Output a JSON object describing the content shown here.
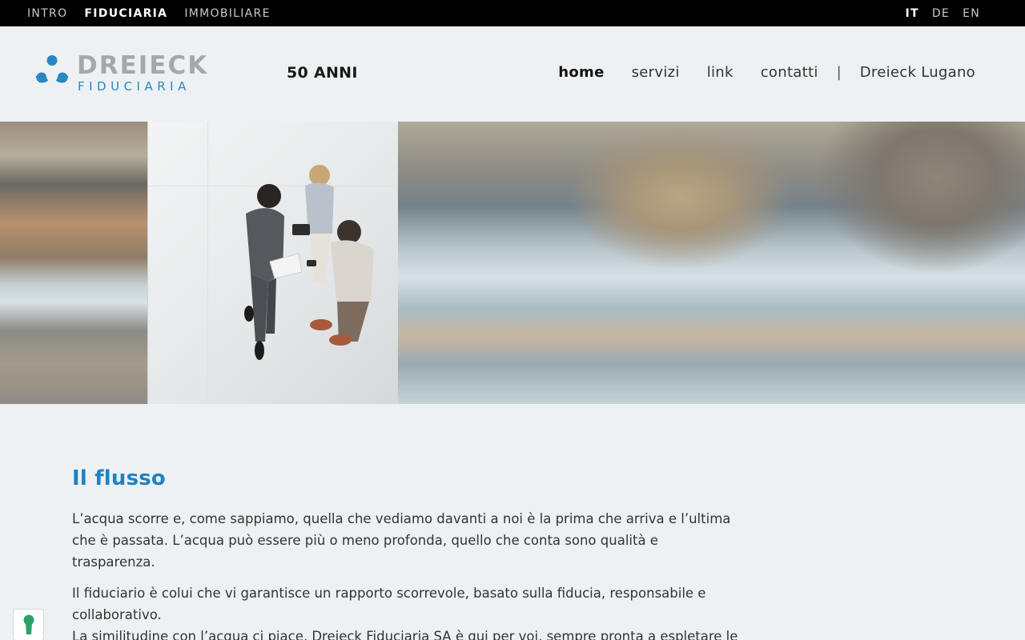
{
  "topbar": {
    "sections": [
      {
        "label": "INTRO",
        "active": false
      },
      {
        "label": "FIDUCIARIA",
        "active": true
      },
      {
        "label": "IMMOBILIARE",
        "active": false
      }
    ],
    "languages": [
      {
        "label": "IT",
        "active": true
      },
      {
        "label": "DE",
        "active": false
      },
      {
        "label": "EN",
        "active": false
      }
    ]
  },
  "header": {
    "logo_name": "DREIECK",
    "logo_sub": "FIDUCIARIA",
    "anniversary": "50 ANNI",
    "nav": [
      {
        "label": "home",
        "active": true
      },
      {
        "label": "servizi",
        "active": false
      },
      {
        "label": "link",
        "active": false
      },
      {
        "label": "contatti",
        "active": false
      }
    ],
    "separator": "|",
    "branch_link": "Dreieck Lugano"
  },
  "main": {
    "title": "Il flusso",
    "paragraph1": "L’acqua scorre e, come sappiamo, quella che vediamo davanti a noi è la prima che arriva e l’ultima che è passata. L’acqua può essere più o meno profonda, quello che conta sono qualità e trasparenza.",
    "paragraph2_line1": "Il fiduciario è colui che vi garantisce un rapporto scorrevole, basato sulla fiducia, responsabile e collaborativo.",
    "paragraph2_line2": "La similitudine con l’acqua ci piace, Dreieck Fiduciaria SA è qui per voi, sempre pronta a espletare le"
  },
  "colors": {
    "accent": "#1f82c3",
    "logo_gray": "#a7a7a7",
    "topbar_bg": "#000000",
    "page_bg": "#eef1f4"
  },
  "icons": {
    "logo": "dreieck-triangle-logo",
    "cookie": "keyhole-icon"
  }
}
